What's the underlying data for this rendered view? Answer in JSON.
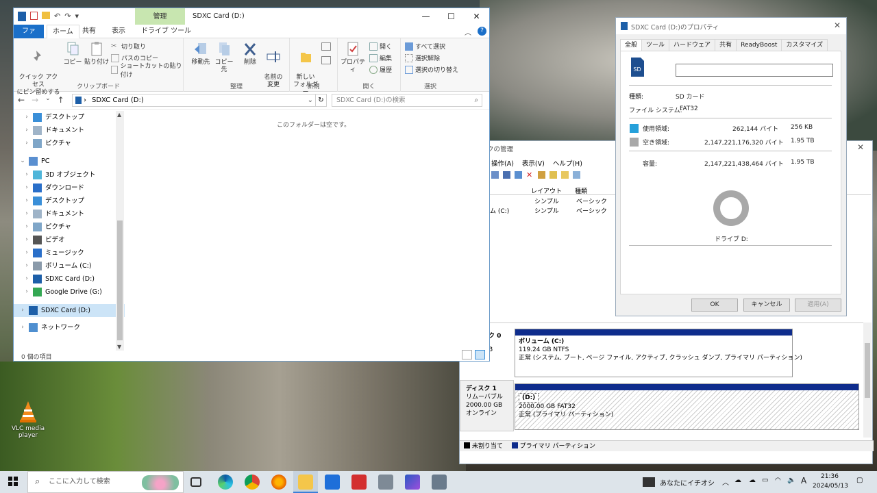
{
  "explorer": {
    "title": "SDXC Card (D:)",
    "context_tab": "管理",
    "window_controls": [
      "—",
      "☐",
      "✕"
    ],
    "tabs": [
      "ファイル",
      "ホーム",
      "共有",
      "表示",
      "ドライブ ツール"
    ],
    "ribbon": {
      "clipboard": {
        "label": "クリップボード",
        "pin": "クイック アクセス\nにピン留めする",
        "copy": "コピー",
        "paste": "貼り付け",
        "cut": "切り取り",
        "copy_path": "パスのコピー",
        "paste_shortcut": "ショートカットの貼り付け"
      },
      "organize": {
        "label": "整理",
        "move_to": "移動先",
        "copy_to": "コピー先",
        "delete": "削除",
        "rename": "名前の\n変更"
      },
      "new": {
        "label": "新規",
        "new_folder": "新しい\nフォルダー"
      },
      "open": {
        "label": "開く",
        "properties": "プロパティ",
        "open": "開く",
        "edit": "編集",
        "history": "履歴"
      },
      "select": {
        "label": "選択",
        "select_all": "すべて選択",
        "select_none": "選択解除",
        "invert": "選択の切り替え"
      }
    },
    "address": "SDXC Card (D:)",
    "search_placeholder": "SDXC Card (D:)の検索",
    "nav": [
      {
        "label": "デスクトップ",
        "icon": "desktop-icon"
      },
      {
        "label": "ドキュメント",
        "icon": "documents-icon"
      },
      {
        "label": "ピクチャ",
        "icon": "pictures-icon"
      },
      {
        "label": "PC",
        "icon": "pc-icon"
      },
      {
        "label": "3D オブジェクト",
        "icon": "3d-objects-icon"
      },
      {
        "label": "ダウンロード",
        "icon": "downloads-icon"
      },
      {
        "label": "デスクトップ",
        "icon": "desktop-icon"
      },
      {
        "label": "ドキュメント",
        "icon": "documents-icon"
      },
      {
        "label": "ピクチャ",
        "icon": "pictures-icon"
      },
      {
        "label": "ビデオ",
        "icon": "videos-icon"
      },
      {
        "label": "ミュージック",
        "icon": "music-icon"
      },
      {
        "label": "ボリューム (C:)",
        "icon": "drive-icon"
      },
      {
        "label": "SDXC Card (D:)",
        "icon": "sd-card-icon"
      },
      {
        "label": "Google Drive (G:)",
        "icon": "google-drive-icon"
      },
      {
        "label": "SDXC Card (D:)",
        "icon": "sd-card-icon"
      },
      {
        "label": "ネットワーク",
        "icon": "network-icon"
      }
    ],
    "empty_message": "このフォルダーは空です。",
    "status": "0 個の項目"
  },
  "properties": {
    "title": "SDXC Card (D:)のプロパティ",
    "tabs": [
      "全般",
      "ツール",
      "ハードウェア",
      "共有",
      "ReadyBoost",
      "カスタマイズ"
    ],
    "type_label": "種類:",
    "type_value": "SD カード",
    "fs_label": "ファイル システム:",
    "fs_value": "FAT32",
    "used_label": "使用領域:",
    "used_bytes": "262,144 バイト",
    "used_size": "256 KB",
    "free_label": "空き領域:",
    "free_bytes": "2,147,221,176,320 バイト",
    "free_size": "1.95 TB",
    "capacity_label": "容量:",
    "capacity_bytes": "2,147,221,438,464 バイト",
    "capacity_size": "1.95 TB",
    "drive_label": "ドライブ D:",
    "used_fraction": 1e-07,
    "ok": "OK",
    "cancel": "キャンセル",
    "apply": "適用(A)",
    "colors": {
      "used": "#26a0da",
      "free": "#a8a8a8"
    }
  },
  "diskmgmt": {
    "title": "クの管理",
    "menu": [
      "操作(A)",
      "表示(V)",
      "ヘルプ(H)"
    ],
    "columns": [
      "レイアウト",
      "種類"
    ],
    "rows": [
      {
        "name": "",
        "layout": "シンプル",
        "type": "ベーシック"
      },
      {
        "name": "ム (C:)",
        "layout": "シンプル",
        "type": "ベーシック"
      }
    ],
    "disk0": {
      "label": "ク 0",
      "sub": "B",
      "vol_name": "ボリューム  (C:)",
      "vol_size": "119.24 GB NTFS",
      "vol_status": "正常 (システム, ブート, ページ ファイル, アクティブ, クラッシュ ダンプ, プライマリ パーティション)"
    },
    "disk1": {
      "label": "ディスク 1",
      "type": "リムーバブル",
      "size": "2000.00 GB",
      "status": "オンライン",
      "vol_name": "(D:)",
      "vol_size": "2000.00 GB FAT32",
      "vol_status": "正常 (プライマリ パーティション)"
    },
    "legend": [
      "未割り当て",
      "プライマリ パーティション"
    ]
  },
  "desktop": {
    "vlc_label": "VLC media player"
  },
  "taskbar": {
    "search_placeholder": "ここに入力して検索",
    "news": "あなたにイチオシ",
    "ime": "A",
    "time": "21:36",
    "date": "2024/05/13"
  }
}
